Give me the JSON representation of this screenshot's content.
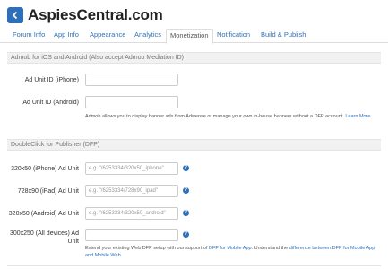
{
  "header": {
    "title": "AspiesCentral.com",
    "back_icon": "chevron-left-icon"
  },
  "tabs": [
    {
      "label": "Forum Info",
      "active": false
    },
    {
      "label": "App Info",
      "active": false
    },
    {
      "label": "Appearance",
      "active": false
    },
    {
      "label": "Analytics",
      "active": false
    },
    {
      "label": "Monetization",
      "active": true
    },
    {
      "label": "Notification",
      "active": false
    },
    {
      "label": "Build & Publish",
      "active": false
    }
  ],
  "admob": {
    "section_title": "Admob for iOS and Android (Also accept Admob Mediation ID)",
    "iphone_label": "Ad Unit ID (iPhone)",
    "iphone_value": "",
    "android_label": "Ad Unit ID (Android)",
    "android_value": "",
    "note_text": "Admob allows you to display banner ads from Adwense or manage your own in-house banners without a DFP account. ",
    "note_link": "Learn More"
  },
  "dfp": {
    "section_title": "DoubleClick for Publisher (DFP)",
    "fields": [
      {
        "label": "320x50 (iPhone) Ad Unit",
        "placeholder": "e.g. \"/6253334/320x50_iphone\""
      },
      {
        "label": "728x90 (iPad) Ad Unit",
        "placeholder": "e.g. \"/6253334/728x90_ipad\""
      },
      {
        "label": "320x50 (Android) Ad Unit",
        "placeholder": "e.g. \"/6253334/320x50_android\""
      },
      {
        "label": "300x250 (All devices) Ad Unit",
        "placeholder": ""
      }
    ],
    "note_pre": "Extend your existing Web DFP setup with our support of ",
    "note_link1": "DFP for Mobile App",
    "note_mid": ". Understand the ",
    "note_link2": "difference between DFP for Mobile App and Mobile Web",
    "note_post": "."
  },
  "colors": {
    "accent": "#2f6fb7",
    "section_bg": "#f1f1f1"
  }
}
